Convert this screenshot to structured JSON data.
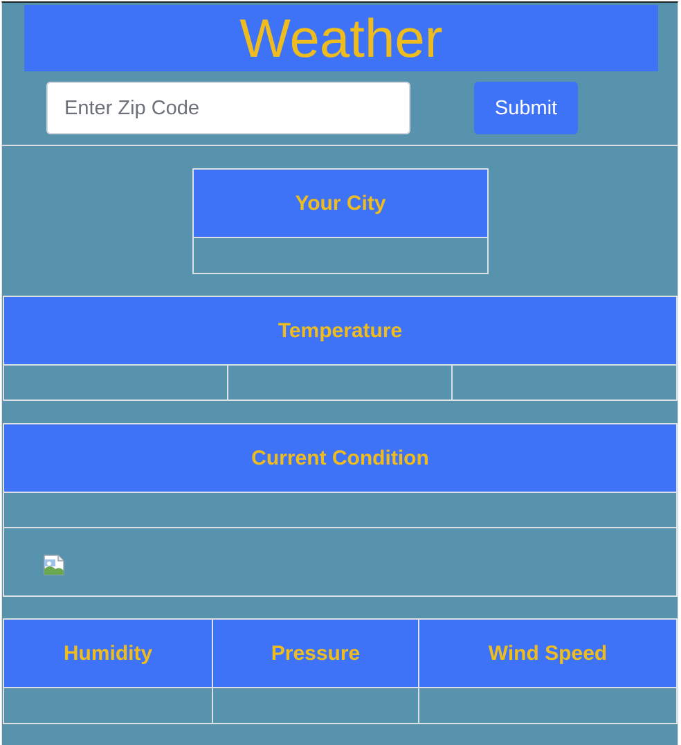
{
  "header": {
    "title": "Weather"
  },
  "search": {
    "placeholder": "Enter Zip Code",
    "value": "",
    "submit_label": "Submit"
  },
  "city": {
    "header": "Your City",
    "value": ""
  },
  "temperature": {
    "header": "Temperature",
    "values": [
      "",
      "",
      ""
    ]
  },
  "condition": {
    "header": "Current Condition",
    "value": "",
    "icon": "broken-image-icon"
  },
  "stats": {
    "headers": [
      "Humidity",
      "Pressure",
      "Wind Speed"
    ],
    "values": [
      "",
      "",
      ""
    ]
  },
  "colors": {
    "background": "#5893ad",
    "accent_blue": "#3e73f8",
    "heading_gold": "#efbc1f",
    "button_text": "#ffffff"
  }
}
